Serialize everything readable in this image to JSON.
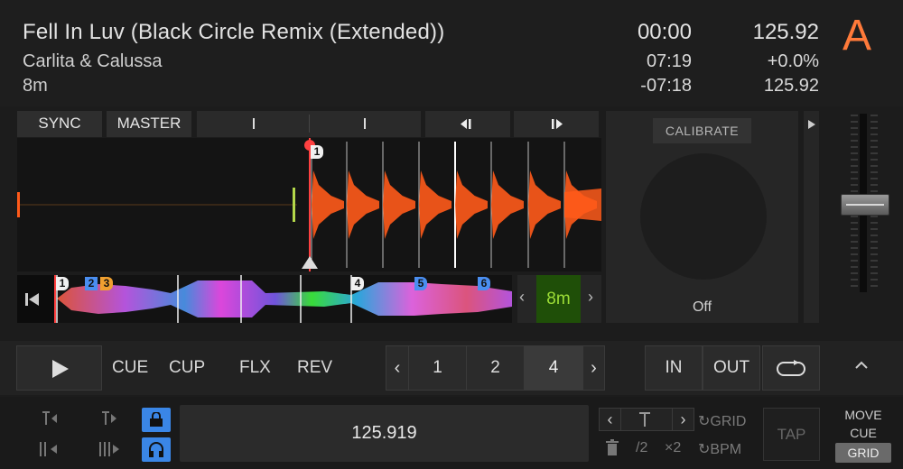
{
  "track": {
    "title": "Fell In Luv (Black Circle Remix (Extended))",
    "artist": "Carlita & Calussa",
    "key": "8m"
  },
  "time": {
    "elapsed": "00:00",
    "total": "07:19",
    "remaining": "-07:18"
  },
  "tempo": {
    "bpm": "125.92",
    "pitch": "+0.0%",
    "original_bpm": "125.92"
  },
  "deck": {
    "letter": "A",
    "accent": "#ff7a3a"
  },
  "top_buttons": {
    "sync": "SYNC",
    "master": "MASTER"
  },
  "jog": {
    "calibrate": "CALIBRATE",
    "state": "Off"
  },
  "cue_points": [
    "1",
    "2",
    "3",
    "4",
    "5",
    "6"
  ],
  "zoom": {
    "value": "8m"
  },
  "transport": {
    "cue": "CUE",
    "cup": "CUP",
    "flx": "FLX",
    "rev": "REV",
    "loop_sizes": [
      "1",
      "2",
      "4"
    ],
    "selected_loop": "4",
    "in": "IN",
    "out": "OUT"
  },
  "bottom": {
    "bpm_value": "125.919",
    "grid_label": "GRID",
    "bpm_label": "BPM",
    "half": "/2",
    "double": "×2",
    "tap": "TAP",
    "move": "MOVE",
    "cue": "CUE",
    "grid_tag": "GRID"
  },
  "colors": {
    "waveform_orange": "#ff5a1a",
    "waveform_green": "#b4d84a",
    "cue_white": "#f0f0f0",
    "cue_blue": "#4a8ef0",
    "cue_orange": "#f0a030",
    "zoom_green": "#9cdd36",
    "accent_blue": "#3a86e6"
  }
}
